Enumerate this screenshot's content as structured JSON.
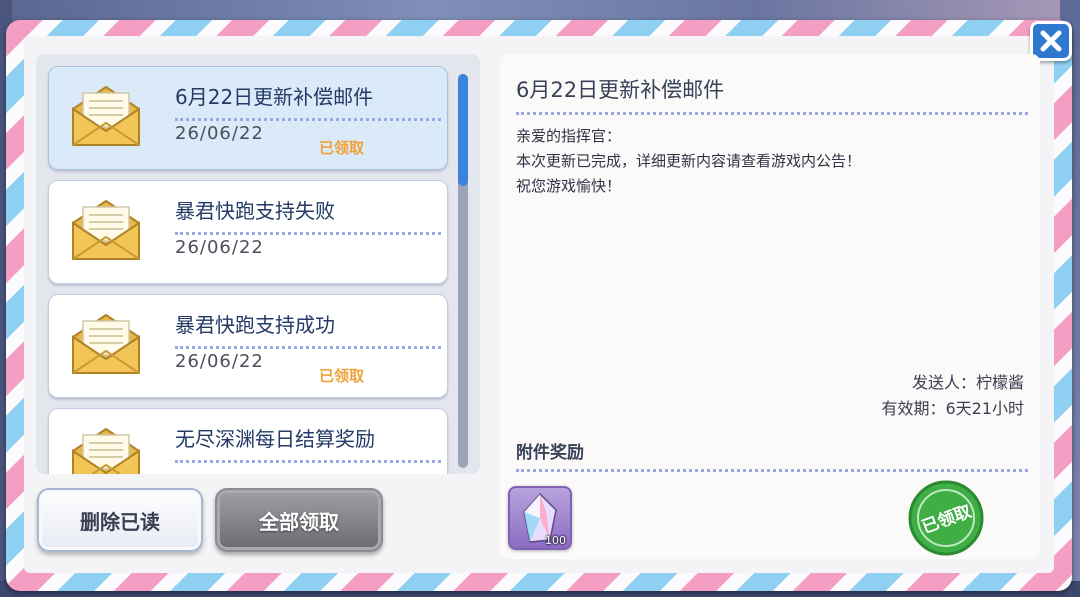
{
  "close_button": {
    "icon": "close-icon"
  },
  "mail_list": {
    "items": [
      {
        "title": "6月22日更新补偿邮件",
        "date": "26/06/22",
        "status": "已领取",
        "selected": true
      },
      {
        "title": "暴君快跑支持失败",
        "date": "26/06/22",
        "status": "",
        "selected": false
      },
      {
        "title": "暴君快跑支持成功",
        "date": "26/06/22",
        "status": "已领取",
        "selected": false
      },
      {
        "title": "无尽深渊每日结算奖励",
        "date": "",
        "status": "",
        "selected": false
      }
    ]
  },
  "buttons": {
    "delete_read": "删除已读",
    "claim_all": "全部领取"
  },
  "detail": {
    "title": "6月22日更新补偿邮件",
    "body_lines": [
      "亲爱的指挥官：",
      "本次更新已完成，详细更新内容请查看游戏内公告！",
      "祝您游戏愉快！"
    ],
    "sender": "发送人：柠檬酱",
    "validity": "有效期：6天21小时",
    "attachments_label": "附件奖励",
    "attachment": {
      "icon": "crystal-icon",
      "quantity": "100"
    },
    "stamp": "已领取"
  },
  "colors": {
    "accent_blue": "#2f78cf",
    "claimed_orange": "#f0a23a",
    "stamp_green": "#3fae45"
  }
}
